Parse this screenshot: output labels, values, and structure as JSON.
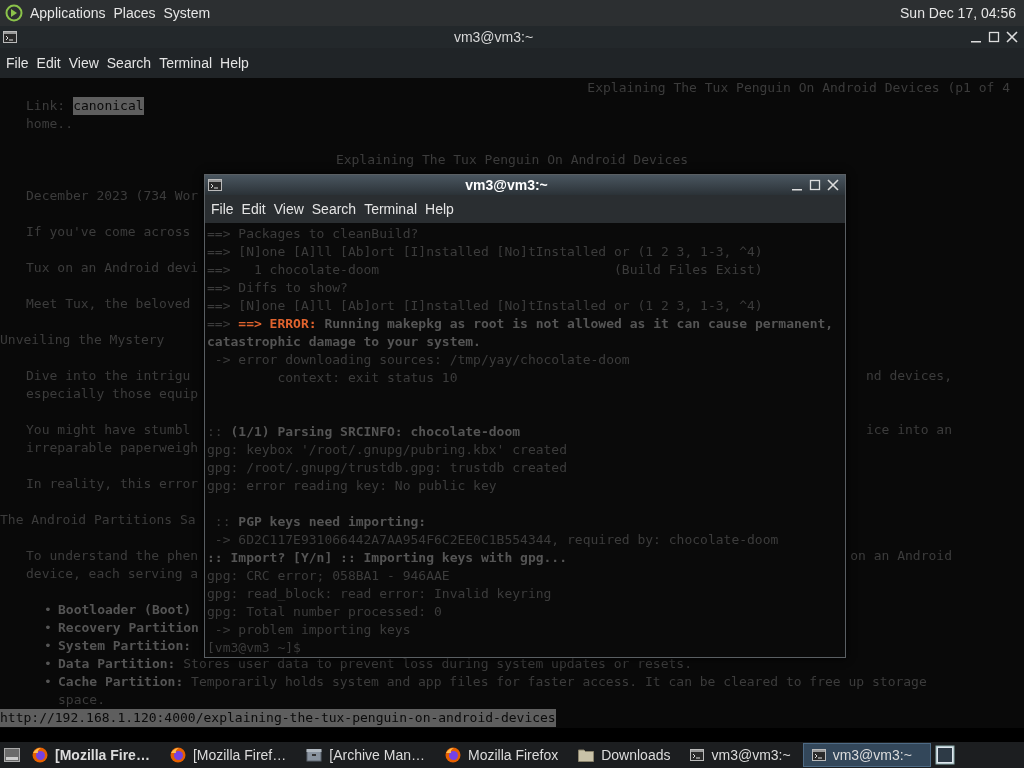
{
  "top_panel": {
    "menus": [
      "Applications",
      "Places",
      "System"
    ],
    "clock": "Sun Dec 17, 04:56"
  },
  "background_terminal": {
    "title": "vm3@vm3:~",
    "menu": [
      "File",
      "Edit",
      "View",
      "Search",
      "Terminal",
      "Help"
    ],
    "lines": [
      {
        "kind": "top-right",
        "text": "Explaining The Tux Penguin On Android Devices (p1 of 4"
      },
      {
        "kind": "link",
        "text": "Link:",
        "link": "canonical"
      },
      {
        "kind": "text",
        "text": "home.."
      },
      {
        "kind": "blank"
      },
      {
        "kind": "center",
        "text": "Explaining The Tux Penguin On Android Devices"
      },
      {
        "kind": "blank"
      },
      {
        "kind": "text",
        "text": "December 2023 (734 Wor"
      },
      {
        "kind": "blank"
      },
      {
        "kind": "text",
        "text": "If you've come across"
      },
      {
        "kind": "blank"
      },
      {
        "kind": "text",
        "text": "Tux on an Android devi"
      },
      {
        "kind": "blank"
      },
      {
        "kind": "text",
        "text": "Meet Tux, the beloved"
      },
      {
        "kind": "blank"
      },
      {
        "kind": "heading",
        "text": "Unveiling the Mystery"
      },
      {
        "kind": "blank"
      },
      {
        "kind": "text",
        "text": "Dive into the intrigu",
        "right": "nd devices,"
      },
      {
        "kind": "text",
        "text": "especially those equip"
      },
      {
        "kind": "blank"
      },
      {
        "kind": "text",
        "text": "You might have stumbl",
        "right": "ice into an"
      },
      {
        "kind": "text",
        "text": "irreparable paperweigh"
      },
      {
        "kind": "blank"
      },
      {
        "kind": "text",
        "text": "In reality, this error"
      },
      {
        "kind": "blank"
      },
      {
        "kind": "heading",
        "text": "The Android Partitions Sa"
      },
      {
        "kind": "blank"
      },
      {
        "kind": "text",
        "text": "To understand the phen",
        "right": "on an Android"
      },
      {
        "kind": "text",
        "text": "device, each serving a"
      },
      {
        "kind": "blank"
      },
      {
        "kind": "bullet",
        "bullet": "•",
        "text": "**Bootloader (Boot)**"
      },
      {
        "kind": "bullet",
        "bullet": "•",
        "text": "**Recovery Partition**"
      },
      {
        "kind": "bullet",
        "bullet": "•",
        "text": "**System Partition:**"
      },
      {
        "kind": "bullet",
        "bullet": "•",
        "text": "**Data Partition:** Stores user data to prevent loss during system updates or resets."
      },
      {
        "kind": "bullet",
        "bullet": "•",
        "text": "**Cache Partition:** Temporarily holds system and app files for faster access. It can be cleared to free up storage"
      },
      {
        "kind": "continuation",
        "text": "space."
      },
      {
        "kind": "url",
        "text": "http://192.168.1.120:4000/explaining-the-tux-penguin-on-android-devices"
      }
    ]
  },
  "terminal": {
    "title": "vm3@vm3:~",
    "menu": [
      "File",
      "Edit",
      "View",
      "Search",
      "Terminal",
      "Help"
    ],
    "lines": [
      {
        "kind": "text",
        "text": "==> Packages to cleanBuild?"
      },
      {
        "kind": "text",
        "text": "==> [N]one [A]ll [Ab]ort [I]nstalled [No]tInstalled or (1 2 3, 1-3, ^4)"
      },
      {
        "kind": "text",
        "text": "==>   1 chocolate-doom                              (Build Files Exist)"
      },
      {
        "kind": "text",
        "text": "==> Diffs to show?"
      },
      {
        "kind": "text",
        "text": "==> [N]one [A]ll [Ab]ort [I]nstalled [No]tInstalled or (1 2 3, 1-3, ^4)"
      },
      {
        "kind": "error",
        "text": "==> ",
        "alert": "==> ERROR:",
        "message": "Running makepkg as root is not allowed as it can cause permanent,"
      },
      {
        "kind": "text",
        "text": "**catastrophic damage to your system.**"
      },
      {
        "kind": "text",
        "text": " -> error downloading sources: /tmp/yay/chocolate-doom"
      },
      {
        "kind": "text",
        "text": "         context: exit status 10"
      },
      {
        "kind": "blank"
      },
      {
        "kind": "blank"
      },
      {
        "kind": "text",
        "text": ":: **(1/1) Parsing SRCINFO: chocolate-doom**"
      },
      {
        "kind": "text",
        "text": "gpg: keybox '/root/.gnupg/pubring.kbx' created"
      },
      {
        "kind": "text",
        "text": "gpg: /root/.gnupg/trustdb.gpg: trustdb created"
      },
      {
        "kind": "text",
        "text": "gpg: error reading key: No public key"
      },
      {
        "kind": "blank"
      },
      {
        "kind": "text",
        "text": " :: **PGP keys need importing:**"
      },
      {
        "kind": "text",
        "text": " -> 6D2C117E931066442A7AA954F6C2EE0C1B554344, required by: chocolate-doom"
      },
      {
        "kind": "text",
        "text": "**:: Import? [Y/n] :: Importing keys with gpg...**"
      },
      {
        "kind": "text",
        "text": "gpg: CRC error; 058BA1 - 946AAE"
      },
      {
        "kind": "text",
        "text": "gpg: read_block: read error: Invalid keyring"
      },
      {
        "kind": "text",
        "text": "gpg: Total number processed: 0"
      },
      {
        "kind": "text",
        "text": " -> problem importing keys"
      },
      {
        "kind": "text",
        "text": "[vm3@vm3 ~]$"
      }
    ]
  },
  "taskbar": {
    "items": [
      {
        "kind": "firefox",
        "label": "[Mozilla Fire…",
        "selected": false,
        "emphasized": true
      },
      {
        "kind": "firefox",
        "label": "[Mozilla Firef…",
        "selected": false,
        "emphasized": false
      },
      {
        "kind": "archive",
        "label": "[Archive Man…",
        "selected": false,
        "emphasized": false
      },
      {
        "kind": "firefox",
        "label": "Mozilla Firefox",
        "selected": false,
        "emphasized": false
      },
      {
        "kind": "folder",
        "label": "Downloads",
        "selected": false,
        "emphasized": false
      },
      {
        "kind": "terminal",
        "label": "vm3@vm3:~",
        "selected": false,
        "emphasized": false
      },
      {
        "kind": "terminal",
        "label": "vm3@vm3:~",
        "selected": true,
        "emphasized": false
      }
    ]
  }
}
